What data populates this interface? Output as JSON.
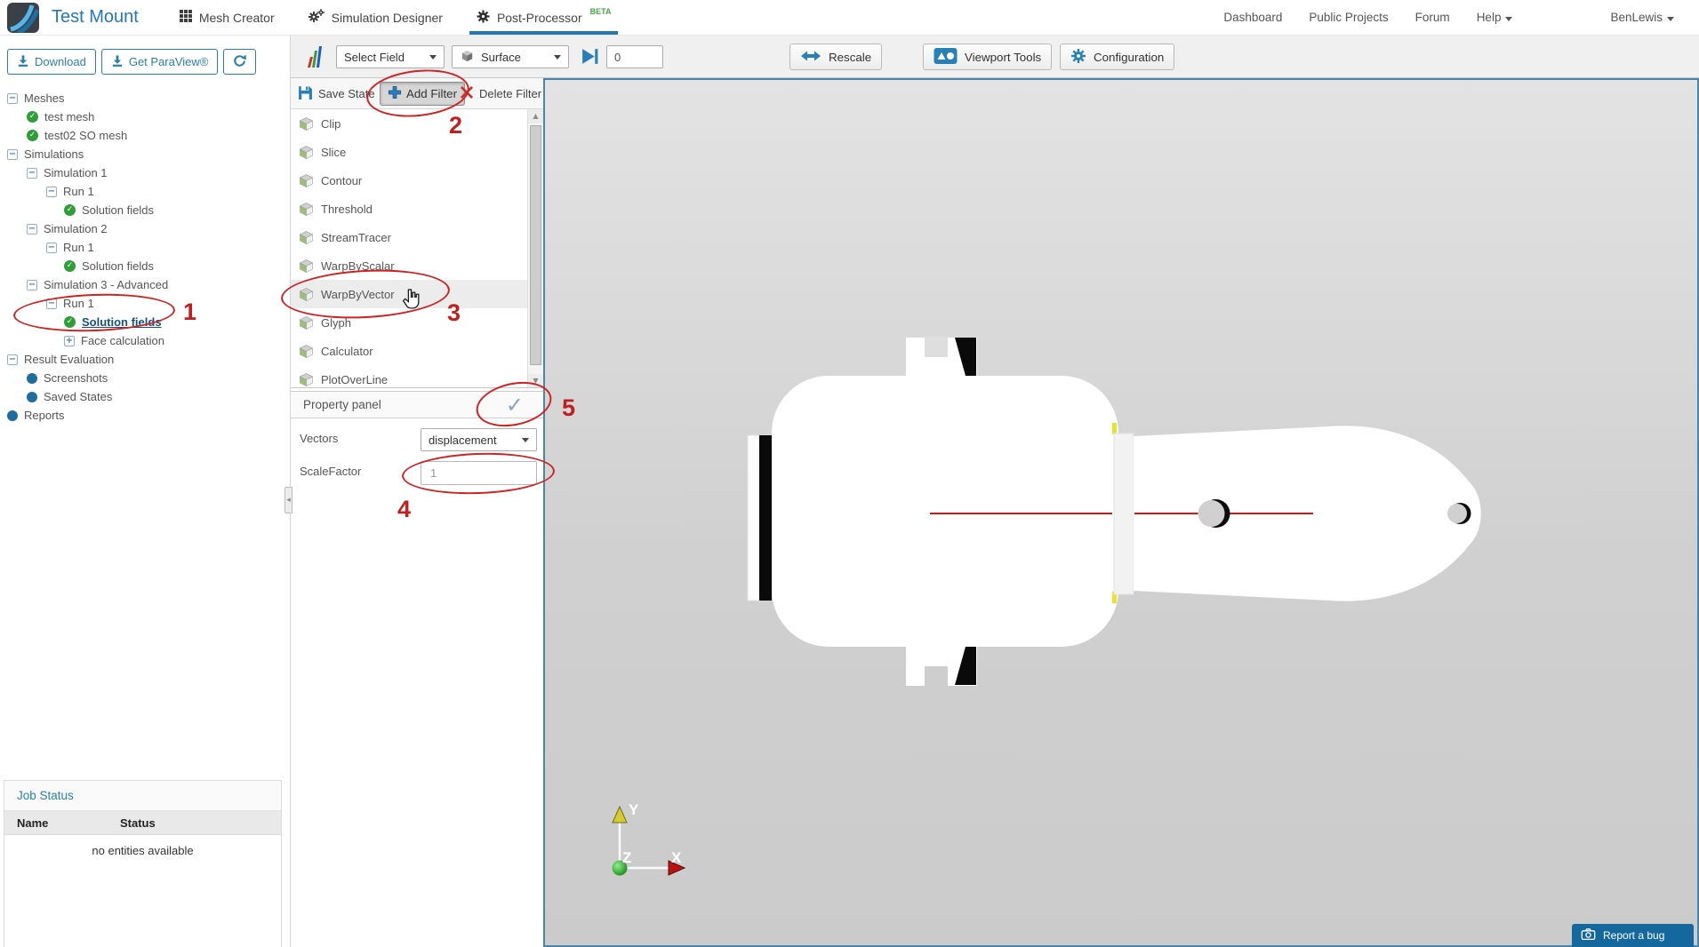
{
  "colors": {
    "brand_blue": "#2278b5",
    "accent_blue": "#2980a9",
    "beta_green": "#46a546",
    "check_green": "#2f9e38",
    "node_blue": "#1d6e9e",
    "viewport_border": "#4c84ac",
    "annotation_red": "#cf2222",
    "model_axis_red": "#e01313",
    "report_bug_blue": "#15689e"
  },
  "icons": {
    "minus": "−",
    "plus": "+",
    "check": "✓",
    "apply_check": "✓",
    "up": "▲",
    "down": "▼"
  },
  "header": {
    "title": "Test Mount",
    "tabs": [
      {
        "label": "Mesh Creator"
      },
      {
        "label": "Simulation Designer"
      },
      {
        "label": "Post-Processor",
        "badge": "BETA"
      }
    ],
    "nav": [
      "Dashboard",
      "Public Projects",
      "Forum",
      "Help"
    ],
    "user": "BenLewis"
  },
  "sidebar": {
    "download": "Download",
    "get_paraview": "Get ParaView®",
    "tree": [
      {
        "label": "Meshes"
      },
      {
        "label": "test mesh"
      },
      {
        "label": "test02 SO mesh"
      },
      {
        "label": "Simulations"
      },
      {
        "label": "Simulation 1"
      },
      {
        "label": "Run 1"
      },
      {
        "label": "Solution fields"
      },
      {
        "label": "Simulation 2"
      },
      {
        "label": "Run 1"
      },
      {
        "label": "Solution fields"
      },
      {
        "label": "Simulation 3 - Advanced"
      },
      {
        "label": "Run 1"
      },
      {
        "label": "Solution fields"
      },
      {
        "label": "Face calculation"
      },
      {
        "label": "Result Evaluation"
      },
      {
        "label": "Screenshots"
      },
      {
        "label": "Saved States"
      },
      {
        "label": "Reports"
      }
    ],
    "job": {
      "title": "Job Status",
      "col_name": "Name",
      "col_status": "Status",
      "empty": "no entities available"
    }
  },
  "toolbar": {
    "select_field": "Select Field",
    "representation": "Surface",
    "frame": "0",
    "rescale": "Rescale",
    "viewport_tools": "Viewport Tools",
    "configuration": "Configuration"
  },
  "filters": {
    "save_state": "Save State",
    "add_filter": "Add Filter",
    "delete_filter": "Delete Filter",
    "items": [
      "Clip",
      "Slice",
      "Contour",
      "Threshold",
      "StreamTracer",
      "WarpByScalar",
      "WarpByVector",
      "Glyph",
      "Calculator",
      "PlotOverLine"
    ]
  },
  "properties": {
    "title": "Property panel",
    "vectors_label": "Vectors",
    "vectors_value": "displacement",
    "scale_label": "ScaleFactor",
    "scale_value": "1"
  },
  "viewport": {
    "axis_x": "X",
    "axis_y": "Y",
    "axis_z": "Z",
    "report_bug": "Report a bug"
  },
  "annotations": {
    "steps": [
      "1",
      "2",
      "3",
      "4",
      "5"
    ]
  }
}
